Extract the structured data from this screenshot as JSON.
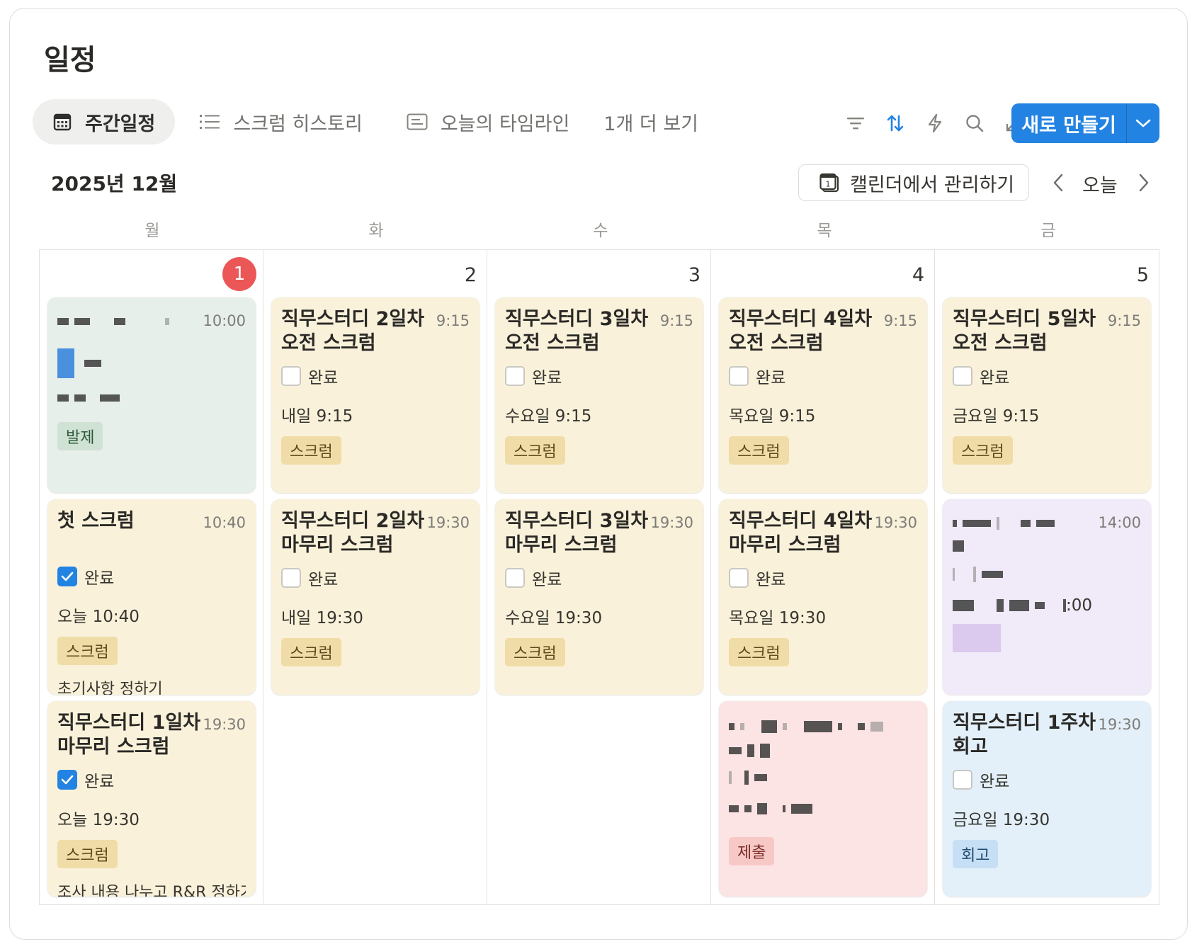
{
  "page": {
    "title": "일정"
  },
  "tabs": [
    {
      "label": "주간일정",
      "icon": "calendar-icon",
      "active": true
    },
    {
      "label": "스크럼 히스토리",
      "icon": "list-icon",
      "active": false
    },
    {
      "label": "오늘의 타임라인",
      "icon": "timeline-icon",
      "active": false
    },
    {
      "label": "1개 더 보기",
      "icon": "",
      "active": false
    }
  ],
  "toolbar": {
    "icons": [
      "filter-icon",
      "sort-icon",
      "automation-icon",
      "search-icon",
      "expand-icon",
      "settings-icon"
    ],
    "new_label": "새로 만들기",
    "accent": "#2383e2"
  },
  "calendar": {
    "month_label": "2025년 12월",
    "manage_label": "캘린더에서 관리하기",
    "today_label": "오늘",
    "weekdays": [
      "월",
      "화",
      "수",
      "목",
      "금"
    ],
    "days": [
      {
        "num": "1",
        "is_today": true,
        "cards": [
          {
            "color": "green",
            "title": "",
            "time": "10:00",
            "redacted": true,
            "tag": "발제"
          },
          {
            "color": "yellow",
            "title": "첫 스크럼",
            "time": "10:40",
            "done_label": "완료",
            "done": true,
            "when": "오늘 10:40",
            "tag": "스크럼",
            "note": "초기사항 정하기"
          },
          {
            "color": "yellow",
            "title": "직무스터디 1일차 마무리 스크럼",
            "time": "19:30",
            "done_label": "완료",
            "done": true,
            "when": "오늘 19:30",
            "tag": "스크럼",
            "note": "조사 내용 나누고 R&R 정하기"
          }
        ]
      },
      {
        "num": "2",
        "is_today": false,
        "cards": [
          {
            "color": "yellow",
            "title": "직무스터디 2일차 오전 스크럼",
            "time": "9:15",
            "done_label": "완료",
            "done": false,
            "when": "내일 9:15",
            "tag": "스크럼"
          },
          {
            "color": "yellow",
            "title": "직무스터디 2일차 마무리 스크럼",
            "time": "19:30",
            "done_label": "완료",
            "done": false,
            "when": "내일 19:30",
            "tag": "스크럼"
          }
        ]
      },
      {
        "num": "3",
        "is_today": false,
        "cards": [
          {
            "color": "yellow",
            "title": "직무스터디 3일차 오전 스크럼",
            "time": "9:15",
            "done_label": "완료",
            "done": false,
            "when": "수요일 9:15",
            "tag": "스크럼"
          },
          {
            "color": "yellow",
            "title": "직무스터디 3일차 마무리 스크럼",
            "time": "19:30",
            "done_label": "완료",
            "done": false,
            "when": "수요일 19:30",
            "tag": "스크럼"
          }
        ]
      },
      {
        "num": "4",
        "is_today": false,
        "cards": [
          {
            "color": "yellow",
            "title": "직무스터디 4일차 오전 스크럼",
            "time": "9:15",
            "done_label": "완료",
            "done": false,
            "when": "목요일 9:15",
            "tag": "스크럼"
          },
          {
            "color": "yellow",
            "title": "직무스터디 4일차 마무리 스크럼",
            "time": "19:30",
            "done_label": "완료",
            "done": false,
            "when": "목요일 19:30",
            "tag": "스크럼"
          },
          {
            "color": "red",
            "title": "",
            "time": "",
            "redacted": true,
            "tag": "제출"
          }
        ]
      },
      {
        "num": "5",
        "is_today": false,
        "cards": [
          {
            "color": "yellow",
            "title": "직무스터디 5일차 오전 스크럼",
            "time": "9:15",
            "done_label": "완료",
            "done": false,
            "when": "금요일 9:15",
            "tag": "스크럼"
          },
          {
            "color": "purple",
            "title": "",
            "time": "14:00",
            "redacted": true,
            "when_tail": ":00",
            "tag": ""
          },
          {
            "color": "blue",
            "title": "직무스터디 1주차 회고",
            "time": "19:30",
            "done_label": "완료",
            "done": false,
            "when": "금요일 19:30",
            "tag": "회고"
          }
        ]
      }
    ]
  }
}
